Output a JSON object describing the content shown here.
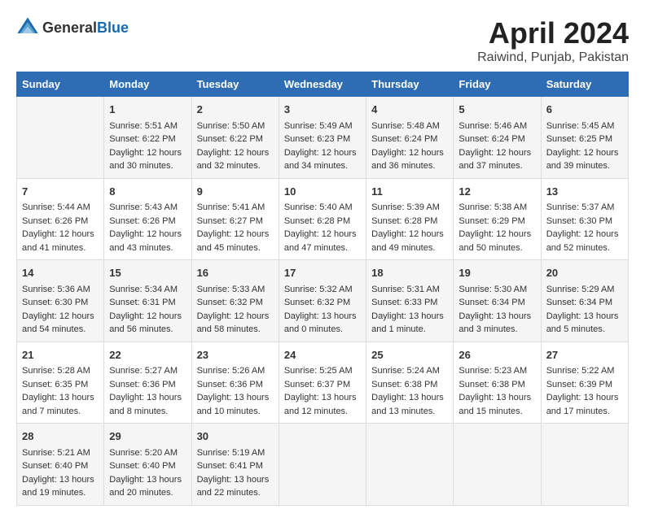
{
  "header": {
    "logo_general": "General",
    "logo_blue": "Blue",
    "title": "April 2024",
    "subtitle": "Raiwind, Punjab, Pakistan"
  },
  "days_of_week": [
    "Sunday",
    "Monday",
    "Tuesday",
    "Wednesday",
    "Thursday",
    "Friday",
    "Saturday"
  ],
  "weeks": [
    [
      {
        "day": "",
        "info": ""
      },
      {
        "day": "1",
        "info": "Sunrise: 5:51 AM\nSunset: 6:22 PM\nDaylight: 12 hours\nand 30 minutes."
      },
      {
        "day": "2",
        "info": "Sunrise: 5:50 AM\nSunset: 6:22 PM\nDaylight: 12 hours\nand 32 minutes."
      },
      {
        "day": "3",
        "info": "Sunrise: 5:49 AM\nSunset: 6:23 PM\nDaylight: 12 hours\nand 34 minutes."
      },
      {
        "day": "4",
        "info": "Sunrise: 5:48 AM\nSunset: 6:24 PM\nDaylight: 12 hours\nand 36 minutes."
      },
      {
        "day": "5",
        "info": "Sunrise: 5:46 AM\nSunset: 6:24 PM\nDaylight: 12 hours\nand 37 minutes."
      },
      {
        "day": "6",
        "info": "Sunrise: 5:45 AM\nSunset: 6:25 PM\nDaylight: 12 hours\nand 39 minutes."
      }
    ],
    [
      {
        "day": "7",
        "info": "Sunrise: 5:44 AM\nSunset: 6:26 PM\nDaylight: 12 hours\nand 41 minutes."
      },
      {
        "day": "8",
        "info": "Sunrise: 5:43 AM\nSunset: 6:26 PM\nDaylight: 12 hours\nand 43 minutes."
      },
      {
        "day": "9",
        "info": "Sunrise: 5:41 AM\nSunset: 6:27 PM\nDaylight: 12 hours\nand 45 minutes."
      },
      {
        "day": "10",
        "info": "Sunrise: 5:40 AM\nSunset: 6:28 PM\nDaylight: 12 hours\nand 47 minutes."
      },
      {
        "day": "11",
        "info": "Sunrise: 5:39 AM\nSunset: 6:28 PM\nDaylight: 12 hours\nand 49 minutes."
      },
      {
        "day": "12",
        "info": "Sunrise: 5:38 AM\nSunset: 6:29 PM\nDaylight: 12 hours\nand 50 minutes."
      },
      {
        "day": "13",
        "info": "Sunrise: 5:37 AM\nSunset: 6:30 PM\nDaylight: 12 hours\nand 52 minutes."
      }
    ],
    [
      {
        "day": "14",
        "info": "Sunrise: 5:36 AM\nSunset: 6:30 PM\nDaylight: 12 hours\nand 54 minutes."
      },
      {
        "day": "15",
        "info": "Sunrise: 5:34 AM\nSunset: 6:31 PM\nDaylight: 12 hours\nand 56 minutes."
      },
      {
        "day": "16",
        "info": "Sunrise: 5:33 AM\nSunset: 6:32 PM\nDaylight: 12 hours\nand 58 minutes."
      },
      {
        "day": "17",
        "info": "Sunrise: 5:32 AM\nSunset: 6:32 PM\nDaylight: 13 hours\nand 0 minutes."
      },
      {
        "day": "18",
        "info": "Sunrise: 5:31 AM\nSunset: 6:33 PM\nDaylight: 13 hours\nand 1 minute."
      },
      {
        "day": "19",
        "info": "Sunrise: 5:30 AM\nSunset: 6:34 PM\nDaylight: 13 hours\nand 3 minutes."
      },
      {
        "day": "20",
        "info": "Sunrise: 5:29 AM\nSunset: 6:34 PM\nDaylight: 13 hours\nand 5 minutes."
      }
    ],
    [
      {
        "day": "21",
        "info": "Sunrise: 5:28 AM\nSunset: 6:35 PM\nDaylight: 13 hours\nand 7 minutes."
      },
      {
        "day": "22",
        "info": "Sunrise: 5:27 AM\nSunset: 6:36 PM\nDaylight: 13 hours\nand 8 minutes."
      },
      {
        "day": "23",
        "info": "Sunrise: 5:26 AM\nSunset: 6:36 PM\nDaylight: 13 hours\nand 10 minutes."
      },
      {
        "day": "24",
        "info": "Sunrise: 5:25 AM\nSunset: 6:37 PM\nDaylight: 13 hours\nand 12 minutes."
      },
      {
        "day": "25",
        "info": "Sunrise: 5:24 AM\nSunset: 6:38 PM\nDaylight: 13 hours\nand 13 minutes."
      },
      {
        "day": "26",
        "info": "Sunrise: 5:23 AM\nSunset: 6:38 PM\nDaylight: 13 hours\nand 15 minutes."
      },
      {
        "day": "27",
        "info": "Sunrise: 5:22 AM\nSunset: 6:39 PM\nDaylight: 13 hours\nand 17 minutes."
      }
    ],
    [
      {
        "day": "28",
        "info": "Sunrise: 5:21 AM\nSunset: 6:40 PM\nDaylight: 13 hours\nand 19 minutes."
      },
      {
        "day": "29",
        "info": "Sunrise: 5:20 AM\nSunset: 6:40 PM\nDaylight: 13 hours\nand 20 minutes."
      },
      {
        "day": "30",
        "info": "Sunrise: 5:19 AM\nSunset: 6:41 PM\nDaylight: 13 hours\nand 22 minutes."
      },
      {
        "day": "",
        "info": ""
      },
      {
        "day": "",
        "info": ""
      },
      {
        "day": "",
        "info": ""
      },
      {
        "day": "",
        "info": ""
      }
    ]
  ]
}
